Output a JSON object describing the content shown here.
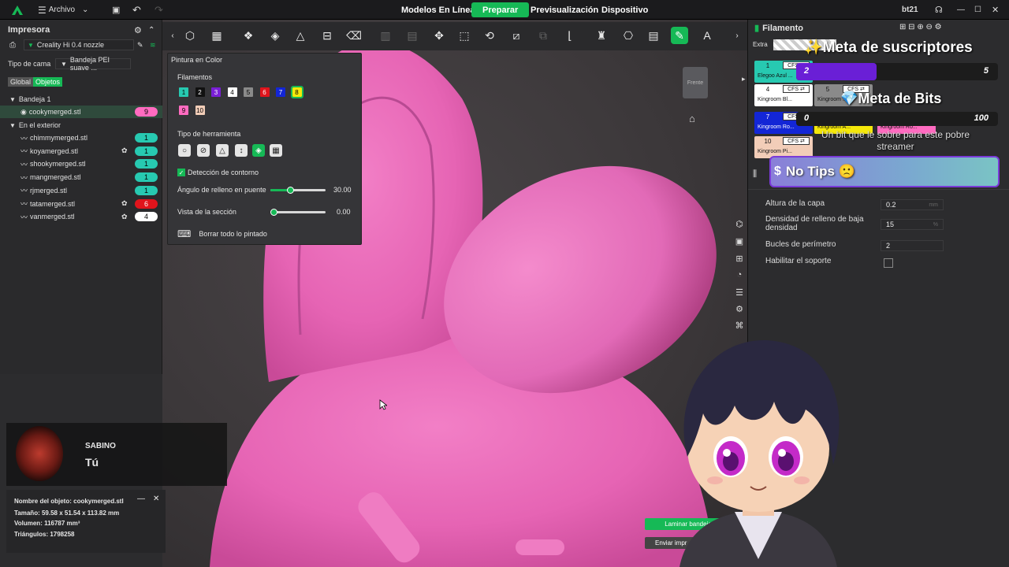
{
  "titlebar": {
    "menu_label": "Archivo",
    "tabs": [
      "Modelos En Línea",
      "Preparar",
      "Previsualización",
      "Dispositivo"
    ],
    "user": "bt21"
  },
  "printer": {
    "title": "Impresora",
    "nozzle": "Creality Hi 0.4 nozzle",
    "bed_label": "Tipo de cama",
    "bed_value": "Bandeja PEI suave ...",
    "seg_global": "Global",
    "seg_objects": "Objetos"
  },
  "tree": {
    "plate": "Bandeja 1",
    "selected": {
      "name": "cookymerged.stl",
      "badge": "9"
    },
    "outside": "En el exterior",
    "items": [
      {
        "name": "chimmymerged.stl",
        "badge": "1",
        "color": "#27c9b1",
        "icon": false
      },
      {
        "name": "koyamerged.stl",
        "badge": "1",
        "color": "#27c9b1",
        "icon": true
      },
      {
        "name": "shookymerged.stl",
        "badge": "1",
        "color": "#27c9b1",
        "icon": false
      },
      {
        "name": "mangmerged.stl",
        "badge": "1",
        "color": "#27c9b1",
        "icon": false
      },
      {
        "name": "rjmerged.stl",
        "badge": "1",
        "color": "#27c9b1",
        "icon": false
      },
      {
        "name": "tatamerged.stl",
        "badge": "6",
        "color": "#e0141c",
        "icon": true
      },
      {
        "name": "vanmerged.stl",
        "badge": "4",
        "color": "#ffffff",
        "icon": true
      }
    ]
  },
  "music": {
    "artist": "SABINO",
    "track": "Tú"
  },
  "info": {
    "name": "Nombre del objeto: cookymerged.stl",
    "size": "Tamaño: 59.58 x 51.54 x 113.82 mm",
    "volume": "Volumen: 116787 mm³",
    "triangles": "Triángulos: 1798258"
  },
  "paint": {
    "title": "Pintura en Color",
    "filaments_label": "Filamentos",
    "filaments": [
      {
        "n": "1",
        "color": "#27c9b1",
        "text": "#000"
      },
      {
        "n": "2",
        "color": "#111111",
        "text": "#fff"
      },
      {
        "n": "3",
        "color": "#7a1fd6",
        "text": "#fff"
      },
      {
        "n": "4",
        "color": "#ffffff",
        "text": "#000"
      },
      {
        "n": "5",
        "color": "#8a8a8a",
        "text": "#000"
      },
      {
        "n": "6",
        "color": "#e0141c",
        "text": "#fff"
      },
      {
        "n": "7",
        "color": "#1326d6",
        "text": "#fff"
      },
      {
        "n": "8",
        "color": "#f5e80a",
        "text": "#000"
      },
      {
        "n": "9",
        "color": "#ff6bc0",
        "text": "#000"
      },
      {
        "n": "10",
        "color": "#f2cdb8",
        "text": "#000"
      }
    ],
    "tool_type_label": "Tipo de herramienta",
    "edge_detect": "Detección de contorno",
    "bridge_angle_label": "Ángulo de relleno en puente",
    "bridge_angle_value": "30.00",
    "bridge_angle_fraction": 0.36,
    "section_label": "Vista de la sección",
    "section_value": "0.00",
    "section_fraction": 0.0,
    "clear_label": "Borrar todo lo pintado"
  },
  "view": {
    "cube_label": "Frente",
    "slice_label": "Laminar bandeja",
    "send_label": "Enviar impr"
  },
  "filament_panel": {
    "title": "Filamento",
    "extra": "Extra",
    "cards": [
      {
        "n": "1",
        "name": "Elegoo Azul ...",
        "color": "#27c9b1"
      },
      {
        "n": "4",
        "name": "Kingroom Bl...",
        "color": "#ffffff"
      },
      {
        "n": "5",
        "name": "Kingroom ...",
        "color": "#8a8a8a"
      },
      {
        "n": "7",
        "name": "Kingroom Ro...",
        "color": "#1326d6"
      },
      {
        "n": "8",
        "name": "Kingroom A...",
        "color": "#f5e80a"
      },
      {
        "n": "9",
        "name": "Kingroom Ro...",
        "color": "#ff6bc0"
      },
      {
        "n": "10",
        "name": "Kingroom Pi...",
        "color": "#f2cdb8"
      }
    ],
    "cfs_label": "CFS ⇄"
  },
  "overlay": {
    "subs_title": "✨Meta de suscriptores",
    "subs_current": "2",
    "subs_goal": "5",
    "bits_title": "💎Meta de Bits",
    "bits_current": "0",
    "bits_goal": "100",
    "bits_text": "Un bit que le sobre para este pobre streamer",
    "tips": "No Tips 🙁"
  },
  "settings": [
    {
      "label": "Altura de la capa",
      "value": "0.2",
      "unit": "mm"
    },
    {
      "label": "Densidad de relleno de baja densidad",
      "value": "15",
      "unit": "%"
    },
    {
      "label": "Bucles de perímetro",
      "value": "2",
      "unit": ""
    },
    {
      "label": "Habilitar el soporte",
      "value": "",
      "unit": ""
    }
  ]
}
